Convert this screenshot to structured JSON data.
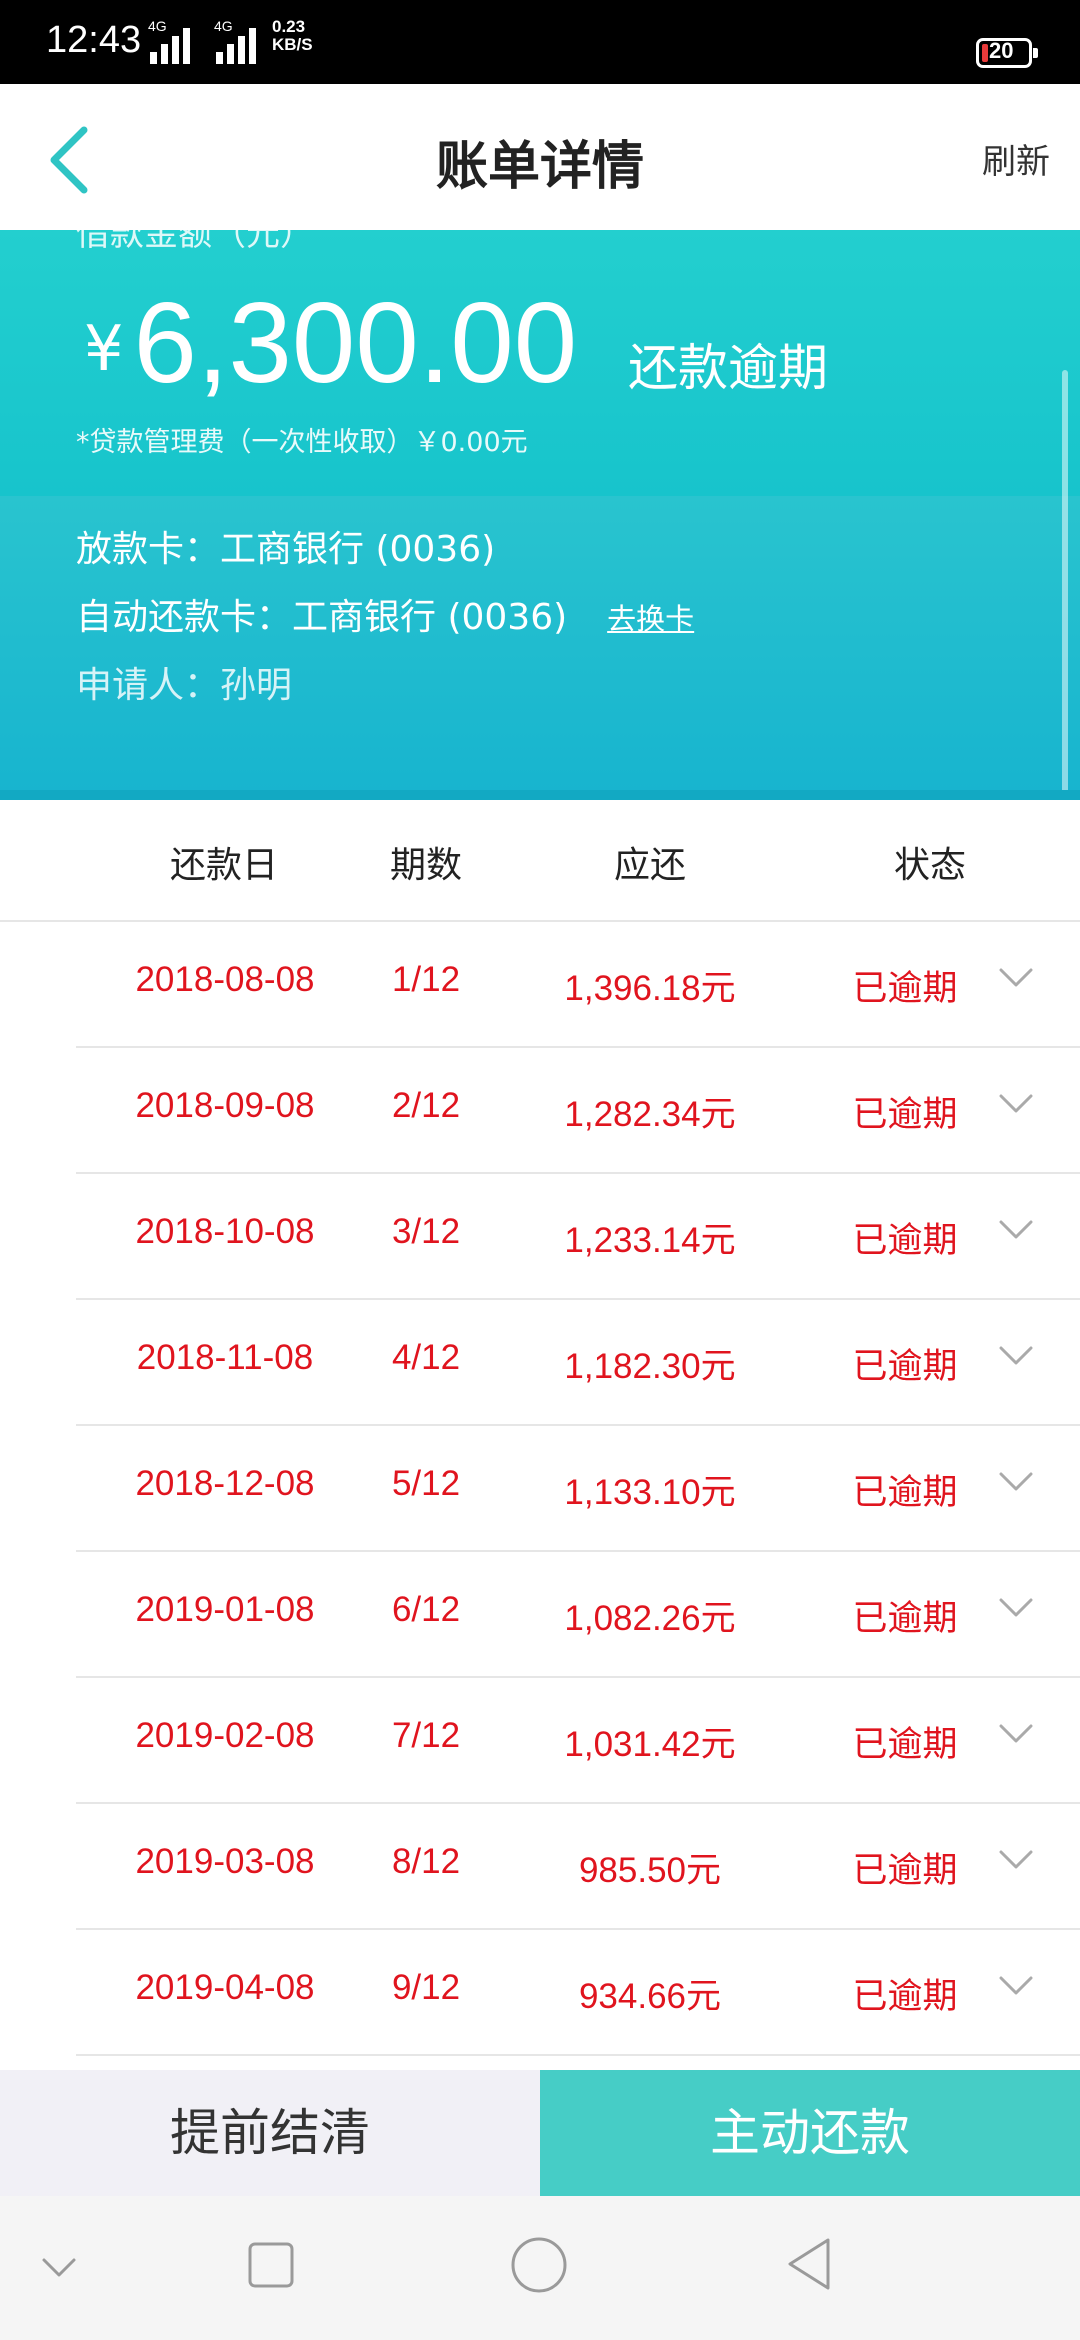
{
  "status_bar": {
    "time": "12:43",
    "network1": "4G",
    "network2": "4G",
    "speed_value": "0.23",
    "speed_unit": "KB/S",
    "battery": "20"
  },
  "header": {
    "title": "账单详情",
    "refresh": "刷新",
    "back_icon": "chevron-left-icon"
  },
  "summary": {
    "amount_label": "借款金额（元）",
    "currency": "¥",
    "amount": "6,300.00",
    "status": "还款逾期",
    "fee_note": "*贷款管理费（一次性收取）￥0.00元"
  },
  "cards": {
    "disburse_card": "放款卡：工商银行 (0036)",
    "autopay_card": "自动还款卡：工商银行 (0036)",
    "change_card": "去换卡",
    "applicant": "申请人：孙明"
  },
  "table": {
    "headers": {
      "date": "还款日",
      "period": "期数",
      "due": "应还",
      "status": "状态"
    },
    "rows": [
      {
        "date": "2018-08-08",
        "period": "1/12",
        "due": "1,396.18元",
        "status": "已逾期"
      },
      {
        "date": "2018-09-08",
        "period": "2/12",
        "due": "1,282.34元",
        "status": "已逾期"
      },
      {
        "date": "2018-10-08",
        "period": "3/12",
        "due": "1,233.14元",
        "status": "已逾期"
      },
      {
        "date": "2018-11-08",
        "period": "4/12",
        "due": "1,182.30元",
        "status": "已逾期"
      },
      {
        "date": "2018-12-08",
        "period": "5/12",
        "due": "1,133.10元",
        "status": "已逾期"
      },
      {
        "date": "2019-01-08",
        "period": "6/12",
        "due": "1,082.26元",
        "status": "已逾期"
      },
      {
        "date": "2019-02-08",
        "period": "7/12",
        "due": "1,031.42元",
        "status": "已逾期"
      },
      {
        "date": "2019-03-08",
        "period": "8/12",
        "due": "985.50元",
        "status": "已逾期"
      },
      {
        "date": "2019-04-08",
        "period": "9/12",
        "due": "934.66元",
        "status": "已逾期"
      }
    ]
  },
  "actions": {
    "prepay": "提前结清",
    "repay": "主动还款"
  },
  "colors": {
    "accent": "#46cdc6",
    "teal": "#1ec8cd",
    "overdue": "#e0141e"
  }
}
